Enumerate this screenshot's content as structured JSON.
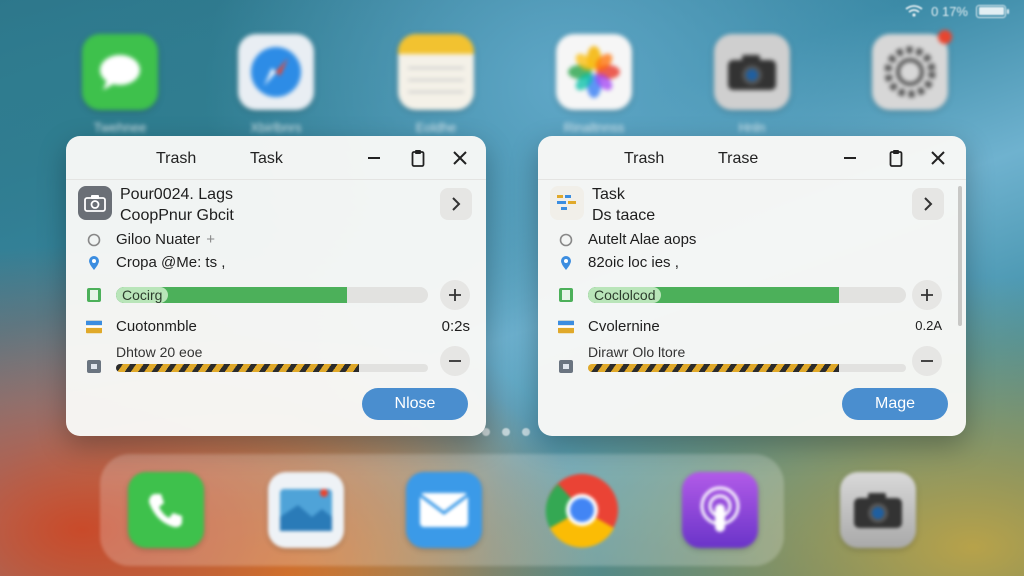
{
  "status": {
    "time_text": "0 17%"
  },
  "home_apps": [
    {
      "name": "messages-app",
      "label": "Twehnee",
      "bg": "#3ec14c",
      "icon": "speech-bubble-icon"
    },
    {
      "name": "safari-app",
      "label": "Xbirlbnrs",
      "bg": "#e9eef3",
      "icon": "compass-icon"
    },
    {
      "name": "notes-app",
      "label": "Eoldhe",
      "bg": "#f4f1e8",
      "icon": "notes-icon"
    },
    {
      "name": "photos-app",
      "label": "Rinaltnnss",
      "bg": "#f6f6f6",
      "icon": "flower-icon"
    },
    {
      "name": "camera-app",
      "label": "Hnln",
      "bg": "#cfcfcf",
      "icon": "camera-icon"
    },
    {
      "name": "settings-app",
      "label": "",
      "bg": "#d7d7d7",
      "icon": "gear-icon"
    }
  ],
  "dock_apps": [
    {
      "name": "phone-app",
      "bg": "#3ec14c",
      "icon": "phone-icon"
    },
    {
      "name": "mail-image-app",
      "bg": "#eef2f6",
      "icon": "image-icon"
    },
    {
      "name": "mail-app",
      "bg": "#3b9ae8",
      "icon": "envelope-icon"
    },
    {
      "name": "chrome-app",
      "bg": "#ffffff",
      "icon": "chrome-icon"
    },
    {
      "name": "podcasts-app",
      "bg": "#9a4de0",
      "icon": "podcast-icon"
    }
  ],
  "panels": {
    "left": {
      "tab1": "Trash",
      "tab2": "Task",
      "header_title": "Pour0024. Lags",
      "header_subtitle": "CoopPnur Gbcit",
      "line1": "Giloo Nuater",
      "line2": "Cropa @Me: ts ,",
      "progress_label": "Cocirg",
      "progress_fraction": 0.74,
      "item_title": "Cuotonmble",
      "item_value": "0:2s",
      "item_sub": "Dhtow 20 eoe",
      "hazard_fraction": 0.78,
      "action_label": "Nlose"
    },
    "right": {
      "tab1": "Trash",
      "tab2": "Trase",
      "header_title": "Task",
      "header_subtitle": "Ds taace",
      "line1": "Autelt Alae aops",
      "line2": "82oic loc ies ,",
      "progress_label": "Coclolcod",
      "progress_fraction": 0.79,
      "item_title": "Cvolernine",
      "item_value": "0.2A",
      "item_sub": "Dirawr Olo ltore",
      "hazard_fraction": 0.79,
      "action_label": "Mage"
    }
  },
  "colors": {
    "progress": "#4cb05a",
    "accent_button": "#4a8ecf",
    "hazard_dark": "#2b2b2b",
    "hazard_yellow": "#e0a92a"
  }
}
